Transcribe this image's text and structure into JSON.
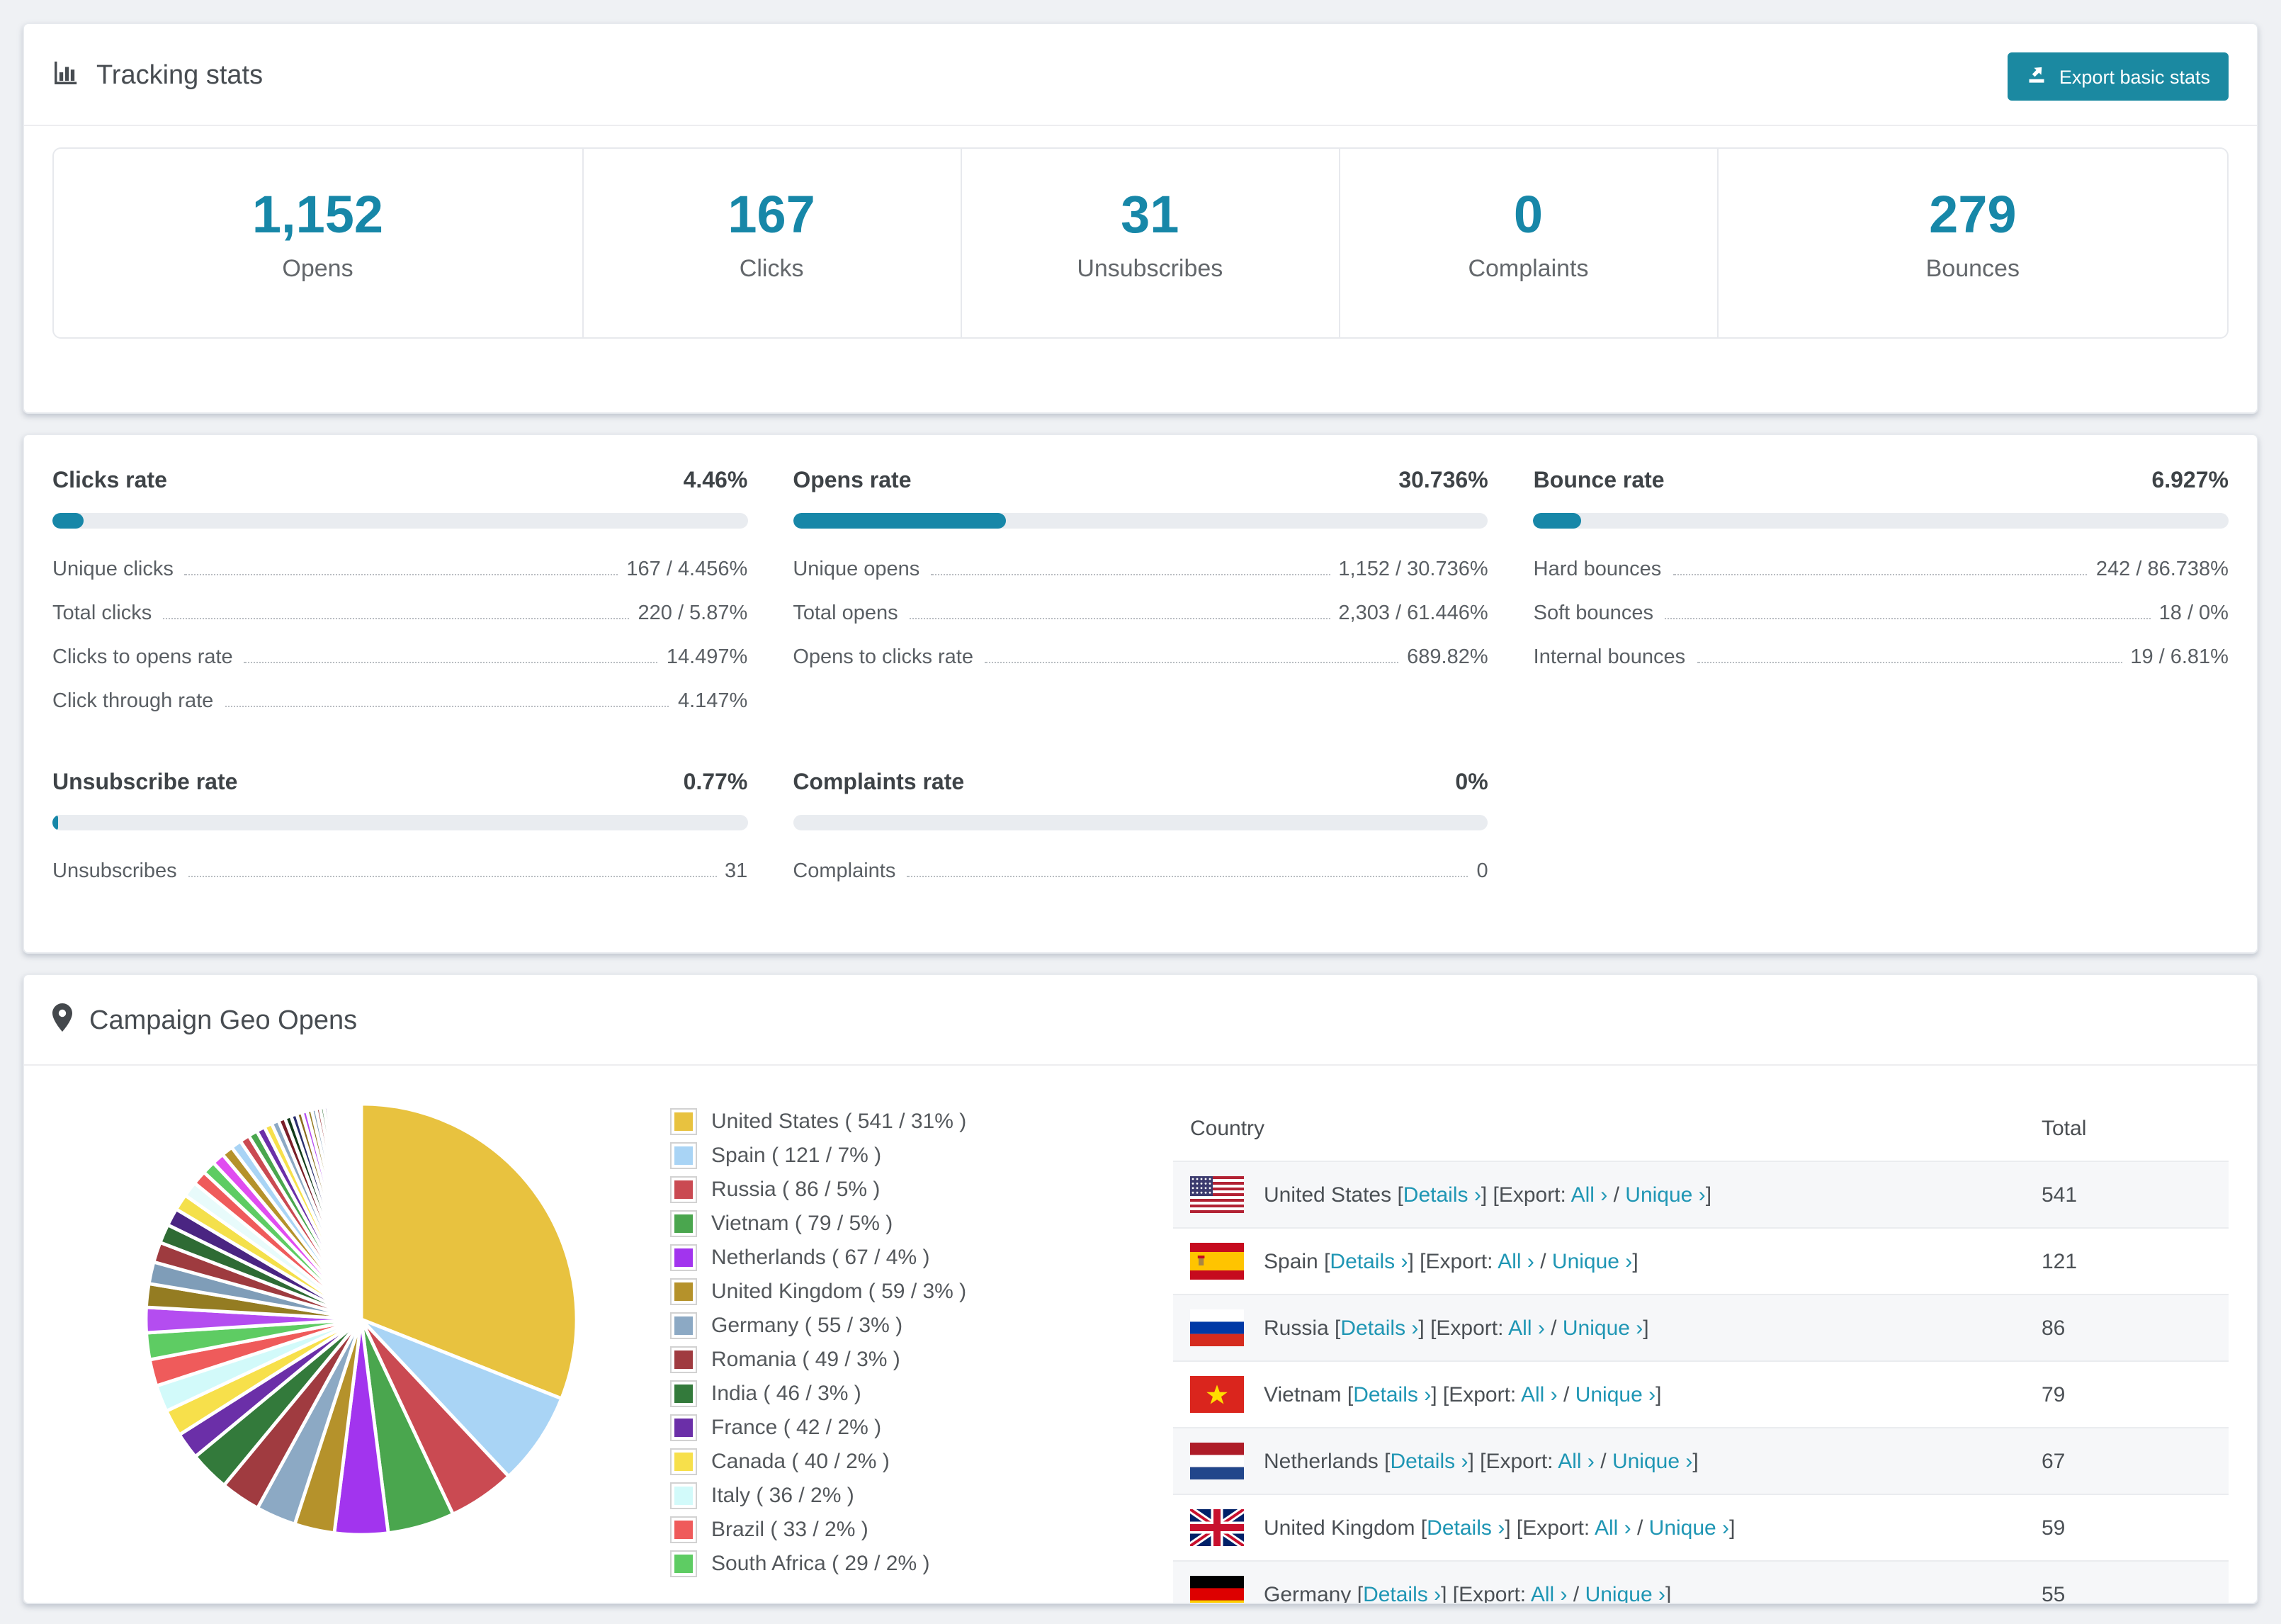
{
  "colors": {
    "accent": "#1787a8",
    "button": "#1b89a1",
    "link": "#1f96b4",
    "page_bg": "#eff1f4",
    "bar_track": "#e9ecf0"
  },
  "tracking": {
    "title": "Tracking stats",
    "export_button": "Export basic stats",
    "summary": [
      {
        "value": "1,152",
        "label": "Opens"
      },
      {
        "value": "167",
        "label": "Clicks"
      },
      {
        "value": "31",
        "label": "Unsubscribes"
      },
      {
        "value": "0",
        "label": "Complaints"
      },
      {
        "value": "279",
        "label": "Bounces"
      }
    ]
  },
  "rates": {
    "sections": [
      {
        "title": "Clicks rate",
        "value": "4.46%",
        "bar_pct": 4.46,
        "rows": [
          {
            "label": "Unique clicks",
            "value": "167 / 4.456%"
          },
          {
            "label": "Total clicks",
            "value": "220 / 5.87%"
          },
          {
            "label": "Clicks to opens rate",
            "value": "14.497%"
          },
          {
            "label": "Click through rate",
            "value": "4.147%"
          }
        ]
      },
      {
        "title": "Opens rate",
        "value": "30.736%",
        "bar_pct": 30.736,
        "rows": [
          {
            "label": "Unique opens",
            "value": "1,152 / 30.736%"
          },
          {
            "label": "Total opens",
            "value": "2,303 / 61.446%"
          },
          {
            "label": "Opens to clicks rate",
            "value": "689.82%"
          }
        ]
      },
      {
        "title": "Bounce rate",
        "value": "6.927%",
        "bar_pct": 6.927,
        "rows": [
          {
            "label": "Hard bounces",
            "value": "242 / 86.738%"
          },
          {
            "label": "Soft bounces",
            "value": "18 / 0%"
          },
          {
            "label": "Internal bounces",
            "value": "19 / 6.81%"
          }
        ]
      },
      {
        "title": "Unsubscribe rate",
        "value": "0.77%",
        "bar_pct": 0.77,
        "rows": [
          {
            "label": "Unsubscribes",
            "value": "31"
          }
        ]
      },
      {
        "title": "Complaints rate",
        "value": "0%",
        "bar_pct": 0,
        "rows": [
          {
            "label": "Complaints",
            "value": "0"
          }
        ]
      }
    ]
  },
  "geo": {
    "title": "Campaign Geo Opens",
    "table": {
      "headers": [
        "Country",
        "Total"
      ],
      "links": {
        "details": "Details ›",
        "export_prefix": "Export:",
        "all": "All ›",
        "unique": "Unique ›"
      },
      "punct": {
        "lb": "[",
        "rb": "]",
        "slash": "/"
      },
      "rows": [
        {
          "country": "United States",
          "flag": "us",
          "total": "541"
        },
        {
          "country": "Spain",
          "flag": "es",
          "total": "121"
        },
        {
          "country": "Russia",
          "flag": "ru",
          "total": "86"
        },
        {
          "country": "Vietnam",
          "flag": "vn",
          "total": "79"
        },
        {
          "country": "Netherlands",
          "flag": "nl",
          "total": "67"
        },
        {
          "country": "United Kingdom",
          "flag": "gb",
          "total": "59"
        },
        {
          "country": "Germany",
          "flag": "de",
          "total": "55",
          "partially_visible": true
        }
      ]
    }
  },
  "chart_data": {
    "type": "pie",
    "title": "Campaign Geo Opens",
    "legend_position": "right",
    "start_angle": "top, clockwise",
    "series": [
      {
        "name": "United States",
        "count": 541,
        "pct": 31,
        "color": "#e8c23f"
      },
      {
        "name": "Spain",
        "count": 121,
        "pct": 7,
        "color": "#a9d4f5"
      },
      {
        "name": "Russia",
        "count": 86,
        "pct": 5,
        "color": "#ca4a52"
      },
      {
        "name": "Vietnam",
        "count": 79,
        "pct": 5,
        "color": "#4aa64e"
      },
      {
        "name": "Netherlands",
        "count": 67,
        "pct": 4,
        "color": "#a234ee"
      },
      {
        "name": "United Kingdom",
        "count": 59,
        "pct": 3,
        "color": "#b5922b"
      },
      {
        "name": "Germany",
        "count": 55,
        "pct": 3,
        "color": "#8ca9c4"
      },
      {
        "name": "Romania",
        "count": 49,
        "pct": 3,
        "color": "#a03b40"
      },
      {
        "name": "India",
        "count": 46,
        "pct": 3,
        "color": "#337a3b"
      },
      {
        "name": "France",
        "count": 42,
        "pct": 2,
        "color": "#6b2fa8"
      },
      {
        "name": "Canada",
        "count": 40,
        "pct": 2,
        "color": "#f7e04b"
      },
      {
        "name": "Italy",
        "count": 36,
        "pct": 2,
        "color": "#d2fafa"
      },
      {
        "name": "Brazil",
        "count": 33,
        "pct": 2,
        "color": "#ef5b5b"
      },
      {
        "name": "South Africa",
        "count": 29,
        "pct": 2,
        "color": "#5ecc63"
      }
    ],
    "others": {
      "total_pct": 26,
      "slice_count_approx": 45,
      "palette": [
        "#b44df0",
        "#947c22",
        "#7f9db8",
        "#9e3b3f",
        "#2e6b34",
        "#4a2582",
        "#f4e04b",
        "#e8fbfb",
        "#ef5b5b",
        "#5ecc63",
        "#e04df0",
        "#b5922b",
        "#a9d4f5",
        "#ca4a52",
        "#4aa64e",
        "#6b2fa8",
        "#f7e04b",
        "#8ca9c4",
        "#7a1f28",
        "#123c1a",
        "#2b2f6e",
        "#8a6d1f"
      ]
    }
  }
}
